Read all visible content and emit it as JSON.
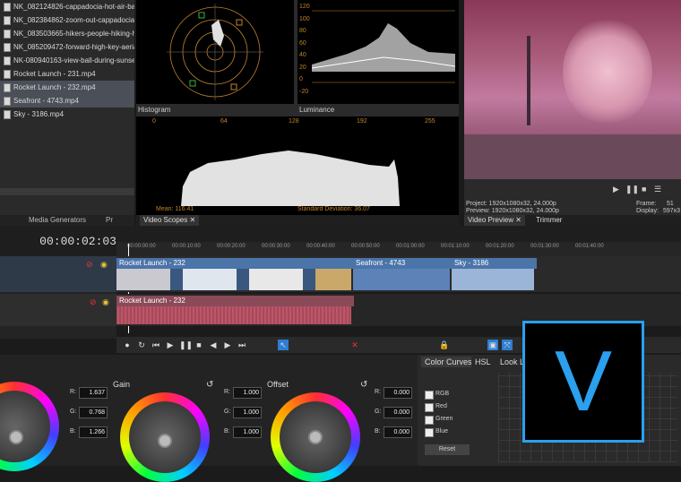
{
  "media_list": {
    "items": [
      "NK_082124826-cappadocia-hot-air-bal...",
      "NK_082384862-zoom-out-cappadocia-...",
      "NK_083503665-hikers-people-hiking-h...",
      "NK_085209472-forward-high-key-aeria...",
      "NK-080940163-view-ball-during-sunse...",
      "Rocket Launch - 231.mp4",
      "Rocket Launch - 232.mp4",
      "Seafront - 4743.mp4",
      "Sky - 3186.mp4"
    ],
    "tabs": [
      "Media Generators",
      "Pr"
    ]
  },
  "scopes": {
    "histogram_label": "Histogram",
    "luminance_label": "Luminance",
    "hist_ticks": [
      "0",
      "64",
      "128",
      "192",
      "255"
    ],
    "mean": "Mean: 116.41",
    "std": "Standard Deviation: 36.07",
    "lum_ticks": [
      "120",
      "100",
      "80",
      "60",
      "40",
      "20",
      "0",
      "-20"
    ],
    "tab": "Video Scopes"
  },
  "preview": {
    "project": "Project:   1920x1080x32, 24.000p",
    "previewinfo": "Preview:  1920x1080x32, 24.000p",
    "frame": "Frame:",
    "frame_val": "51",
    "display": "Display:",
    "display_val": "597x3",
    "tab": "Video Preview",
    "tab2": "Trimmer"
  },
  "timeline": {
    "timecode": "00:00:02:03",
    "ruler": [
      "00:00:00:00",
      "00:00:10:00",
      "00:00:20:00",
      "00:00:30:00",
      "00:00:40:00",
      "00:00:50:00",
      "00:01:00:00",
      "00:01:10:00",
      "00:01:20:00",
      "00:01:30:00",
      "00:01:40:00"
    ],
    "video_clips": [
      "Rocket Launch - 232",
      "Seafront - 4743",
      "Sky - 3186"
    ],
    "audio_clip": "Rocket Launch - 232"
  },
  "color": {
    "gain_title": "Gain",
    "offset_title": "Offset",
    "left_vals": {
      "r": "1.637",
      "g": "0.768",
      "b": "1.266"
    },
    "gain_vals": {
      "r": "1.000",
      "g": "1.000",
      "b": "1.000"
    },
    "offset_vals": {
      "r": "0.000",
      "g": "0.000",
      "b": "0.000"
    },
    "labels": {
      "r": "R:",
      "g": "G:",
      "b": "B:"
    }
  },
  "curves": {
    "tabs": [
      "Color Curves",
      "HSL",
      "Look Lo"
    ],
    "channels": [
      "RGB",
      "Red",
      "Green",
      "Blue"
    ],
    "reset": "Reset"
  },
  "logo": {
    "letter": "V",
    "color": "#2aa0ee"
  }
}
